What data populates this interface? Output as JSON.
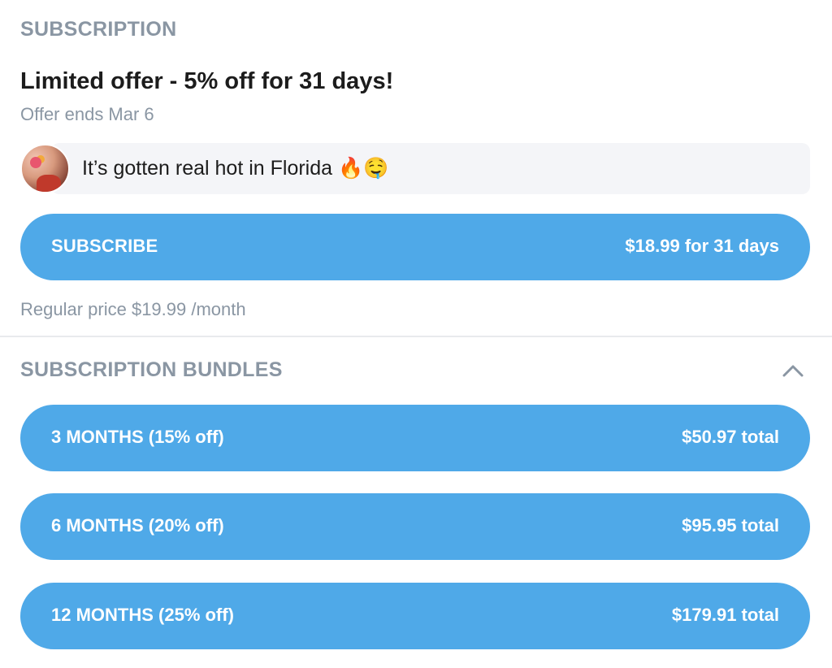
{
  "subscription": {
    "section_title": "SUBSCRIPTION",
    "offer_title": "Limited offer - 5% off for 31 days!",
    "offer_ends": "Offer ends Mar 6",
    "message": {
      "text": "It’s gotten real hot in Florida 🔥🤤"
    },
    "subscribe_button": {
      "label": "SUBSCRIBE",
      "price": "$18.99 for 31 days"
    },
    "regular_price": "Regular price $19.99 /month"
  },
  "bundles": {
    "section_title": "SUBSCRIPTION BUNDLES",
    "toggle_icon": "chevron-up-icon",
    "items": [
      {
        "label": "3 MONTHS (15% off)",
        "price": "$50.97 total"
      },
      {
        "label": "6 MONTHS (20% off)",
        "price": "$95.95 total"
      },
      {
        "label": "12 MONTHS (25% off)",
        "price": "$179.91 total"
      }
    ]
  },
  "colors": {
    "accent": "#4fa9e8",
    "muted_text": "#8a96a3",
    "bubble_bg": "#f4f5f8"
  }
}
